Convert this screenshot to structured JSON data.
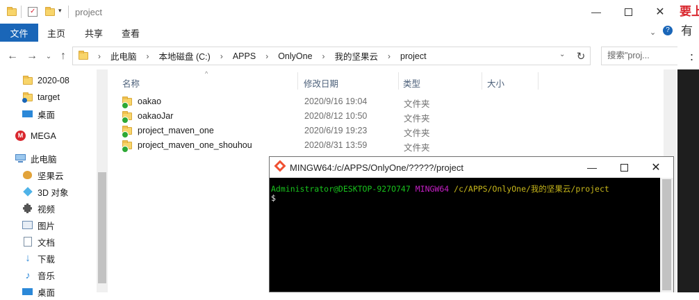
{
  "explorer": {
    "title": "project",
    "ribbon_tabs": [
      "文件",
      "主页",
      "共享",
      "查看"
    ],
    "breadcrumb": [
      "此电脑",
      "本地磁盘 (C:)",
      "APPS",
      "OnlyOne",
      "我的坚果云",
      "project"
    ],
    "search_placeholder": "搜索\"proj...",
    "nav_items": [
      {
        "label": "2020-08",
        "icon": "folder-icon"
      },
      {
        "label": "target",
        "icon": "folder-sync-icon"
      },
      {
        "label": "桌面",
        "icon": "desktop-icon"
      },
      {
        "label": "MEGA",
        "icon": "mega-icon"
      },
      {
        "label": "此电脑",
        "icon": "computer-icon"
      },
      {
        "label": "坚果云",
        "icon": "nutstore-icon"
      },
      {
        "label": "3D 对象",
        "icon": "3d-objects-icon"
      },
      {
        "label": "视频",
        "icon": "video-icon"
      },
      {
        "label": "图片",
        "icon": "pictures-icon"
      },
      {
        "label": "文档",
        "icon": "documents-icon"
      },
      {
        "label": "下载",
        "icon": "download-icon"
      },
      {
        "label": "音乐",
        "icon": "music-icon"
      },
      {
        "label": "桌面",
        "icon": "desktop-icon"
      }
    ],
    "columns": [
      "名称",
      "修改日期",
      "类型",
      "大小"
    ],
    "files": [
      {
        "name": "oakao",
        "date": "2020/9/16 19:04",
        "type": "文件夹"
      },
      {
        "name": "oakaoJar",
        "date": "2020/8/12 10:50",
        "type": "文件夹"
      },
      {
        "name": "project_maven_one",
        "date": "2020/6/19 19:23",
        "type": "文件夹"
      },
      {
        "name": "project_maven_one_shouhou",
        "date": "2020/8/31 13:59",
        "type": "文件夹"
      }
    ]
  },
  "background_text": {
    "line1": "要上",
    "line2": "有",
    "line3": "："
  },
  "terminal": {
    "title": "MINGW64:/c/APPS/OnlyOne/?????/project",
    "prompt_user": "Administrator@DESKTOP-927O747",
    "prompt_shell": "MINGW64",
    "prompt_path": "/c/APPS/OnlyOne/我的坚果云/project",
    "prompt_symbol": "$"
  },
  "colors": {
    "accent": "#1a66b8",
    "term_user": "#19c31d",
    "term_shell": "#c61fc6",
    "term_path": "#c8b81b"
  }
}
